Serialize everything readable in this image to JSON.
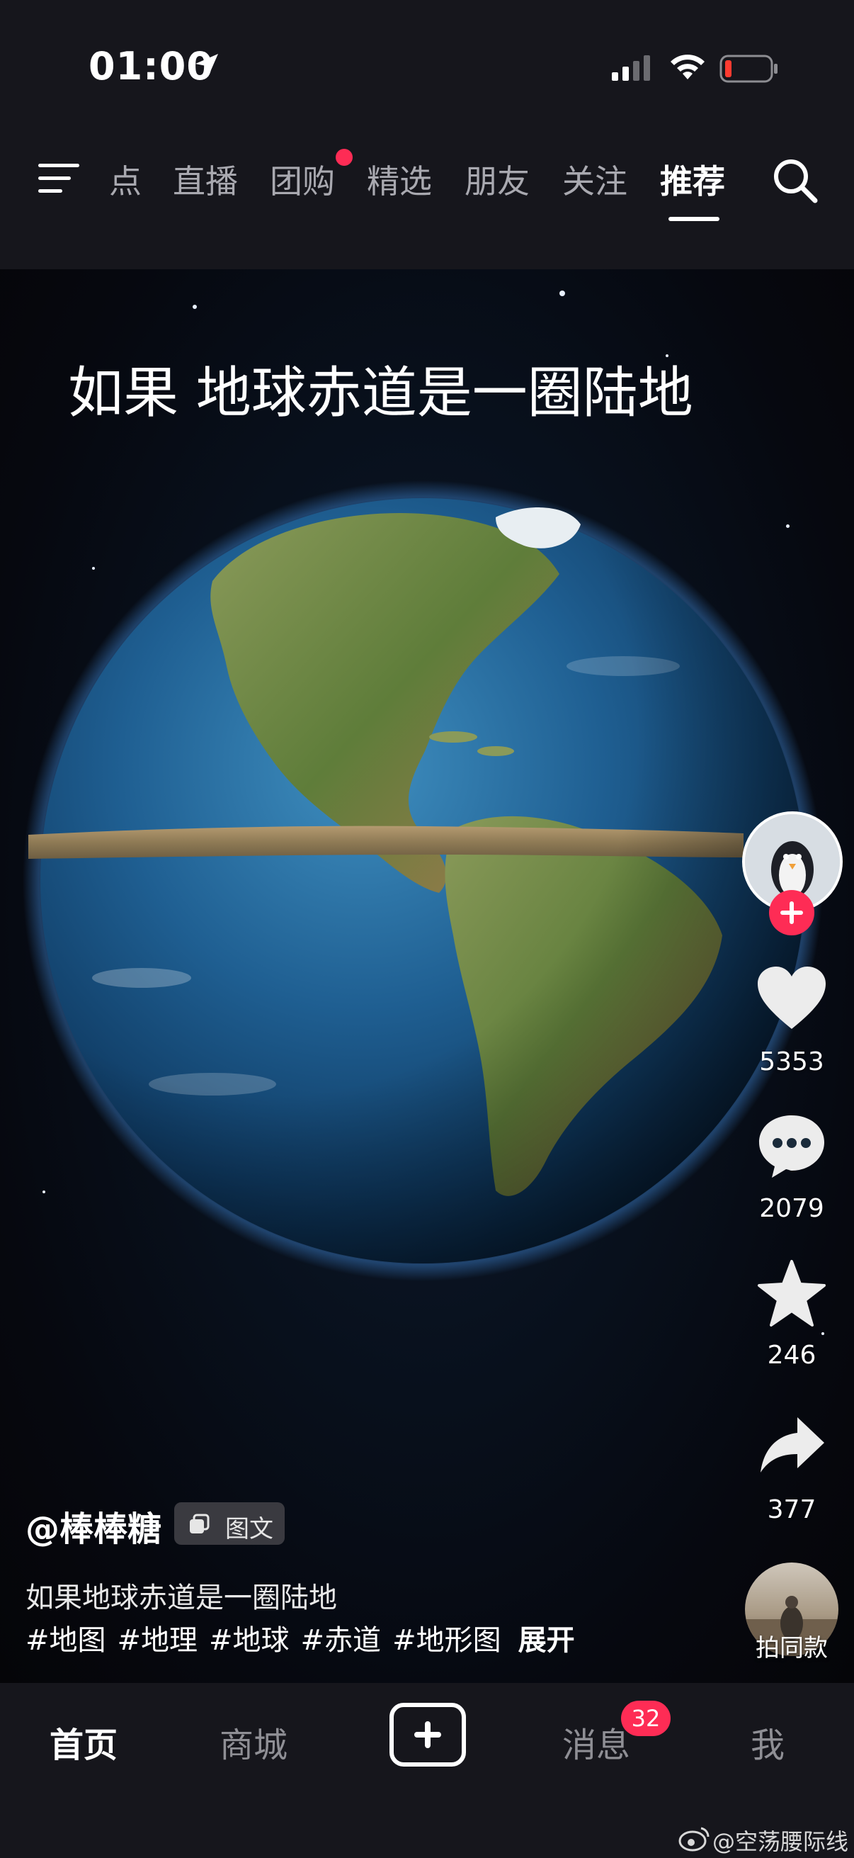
{
  "status_bar": {
    "time": "01:00",
    "icons": [
      "location-arrow-icon",
      "cellular-signal-icon",
      "wifi-icon",
      "battery-low-icon"
    ],
    "battery_color": "#ff3b30"
  },
  "top_nav": {
    "menu_icon": "hamburger-menu-icon",
    "tabs": [
      {
        "label": "点",
        "active": false
      },
      {
        "label": "直播",
        "active": false
      },
      {
        "label": "团购",
        "active": false,
        "has_dot": true
      },
      {
        "label": "精选",
        "active": false
      },
      {
        "label": "朋友",
        "active": false
      },
      {
        "label": "关注",
        "active": false
      },
      {
        "label": "推荐",
        "active": true
      }
    ],
    "search_icon": "search-icon"
  },
  "video": {
    "overlay_title": "如果 地球赤道是一圈陆地"
  },
  "sidebar": {
    "avatar_icon": "penguin-avatar",
    "follow_icon": "plus-icon",
    "likes": "5353",
    "comments": "2079",
    "favorites": "246",
    "shares": "377",
    "remix_label": "拍同款"
  },
  "caption": {
    "author": "@棒棒糖",
    "type_badge": "图文",
    "description": "如果地球赤道是一圈陆地",
    "tags": [
      "#地图",
      "#地理",
      "#地球",
      "#赤道",
      "#地形图"
    ],
    "expand_label": "展开"
  },
  "bottom_nav": {
    "items": [
      {
        "label": "首页",
        "active": true
      },
      {
        "label": "商城",
        "active": false
      },
      {
        "label": "消息",
        "active": false
      },
      {
        "label": "我",
        "active": false
      }
    ],
    "create_icon": "plus-icon",
    "message_badge": "32"
  },
  "watermark": {
    "icon": "weibo-icon",
    "text": "@空荡腰际线"
  },
  "colors": {
    "accent": "#fe2c55",
    "bar_background": "#16161c"
  }
}
